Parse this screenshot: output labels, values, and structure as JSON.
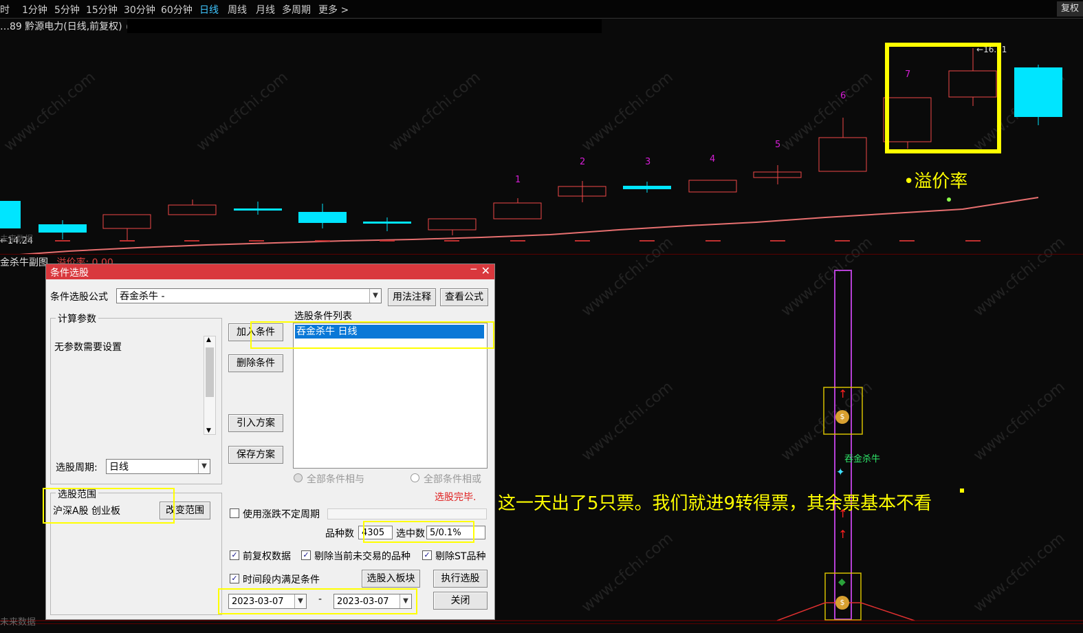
{
  "toolbar": {
    "tabs": [
      "分时",
      "1分钟",
      "5分钟",
      "15分钟",
      "30分钟",
      "60分钟",
      "日线",
      "周线",
      "月线",
      "多周期",
      "更多 >"
    ],
    "active_tab": "日线",
    "restore_label": "复权"
  },
  "chart": {
    "stock_title": "…89 黔源电力(日线,前复权)",
    "price_high_label": "16.61",
    "price_low_label": "14.24",
    "no_data_label": "未来数据",
    "candle_counts": [
      "1",
      "2",
      "3",
      "4",
      "5",
      "6",
      "7"
    ],
    "annotation_premium": "溢价率",
    "annotation_note": "这一天出了5只票。我们就进9转得票，其余票基本不看",
    "colors": {
      "up": "#f04848",
      "down": "#00e5ff",
      "count": "#d61ed6",
      "ma_line": "#e87070",
      "highlight": "#ffff00"
    }
  },
  "subchart": {
    "title": "金杀牛副图",
    "value_label": "溢价率: 0.00",
    "signal_label": "吞金杀牛",
    "no_data_label": "未来数据"
  },
  "dialog": {
    "title": "条件选股",
    "formula_label": "条件选股公式",
    "formula_value": "吞金杀牛      -",
    "usage_button": "用法注释",
    "view_formula_button": "查看公式",
    "params_group": "计算参数",
    "params_text": "无参数需要设置",
    "period_label": "选股周期:",
    "period_value": "日线",
    "range_group": "选股范围",
    "range_value": "沪深A股 创业板",
    "change_range_button": "改变范围",
    "add_condition_button": "加入条件",
    "delete_condition_button": "删除条件",
    "import_plan_button": "引入方案",
    "save_plan_button": "保存方案",
    "conditions_list_label": "选股条件列表",
    "conditions": [
      "吞金杀牛   日线"
    ],
    "all_and_label": "全部条件相与",
    "all_or_label": "全部条件相或",
    "status_text": "选股完毕.",
    "use_variable_period_label": "使用涨跌不定周期",
    "variety_count_label": "品种数",
    "variety_count_value": "4305",
    "selected_count_label": "选中数",
    "selected_count_value": "5/0.1%",
    "pre_adjusted_label": "前复权数据",
    "exclude_untraded_label": "剔除当前未交易的品种",
    "exclude_st_label": "剔除ST品种",
    "time_range_label": "时间段内满足条件",
    "to_block_button": "选股入板块",
    "execute_button": "执行选股",
    "date_start": "2023-03-07",
    "date_sep": "-",
    "date_end": "2023-03-07",
    "close_button": "关闭"
  },
  "watermark_text": "www.cfchi.com"
}
